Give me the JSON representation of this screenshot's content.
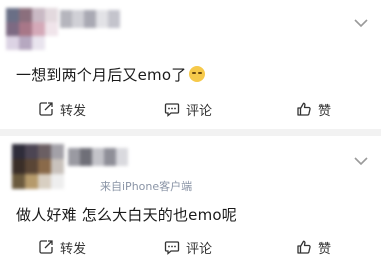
{
  "posts": [
    {
      "text": "一想到两个月后又emo了",
      "emoji": "flushed-face-emoji",
      "actions": {
        "repost": "转发",
        "comment": "评论",
        "like": "赞"
      }
    },
    {
      "source": "来自iPhone客户端",
      "text": "做人好难 怎么大白天的也emo呢",
      "actions": {
        "repost": "转发",
        "comment": "评论",
        "like": "赞"
      }
    }
  ],
  "colors": {
    "divider": "#f2f2f2",
    "source_text": "#8a94a6",
    "emoji": "#f6c94a"
  }
}
